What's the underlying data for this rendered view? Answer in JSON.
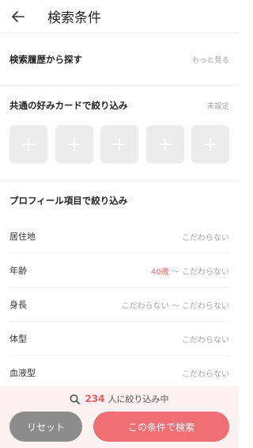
{
  "header": {
    "title": "検索条件",
    "back_icon": "arrow-left-icon"
  },
  "history": {
    "title": "検索履歴から探す",
    "more": "もっと見る"
  },
  "cards": {
    "title": "共通の好みカードで絞り込み",
    "status": "未設定",
    "slots": [
      "+",
      "+",
      "+",
      "+",
      "+"
    ]
  },
  "profile": {
    "title": "プロフィール項目で絞り込み",
    "rows": [
      {
        "label": "居住地",
        "value": "こだわらない"
      },
      {
        "label": "年齢",
        "value_min": "40歳",
        "value_sep": " 〜 ",
        "value_max": "こだわらない"
      },
      {
        "label": "身長",
        "value_min": "こだわらない",
        "value_sep": " 〜 ",
        "value_max": "こだわらない"
      },
      {
        "label": "体型",
        "value": "こだわらない"
      },
      {
        "label": "血液型",
        "value": "こだわらない"
      }
    ]
  },
  "footer": {
    "count": "234",
    "count_suffix": "人に絞り込み中",
    "reset_label": "リセット",
    "search_label": "この条件で検索",
    "accent_color": "#f06e74"
  }
}
